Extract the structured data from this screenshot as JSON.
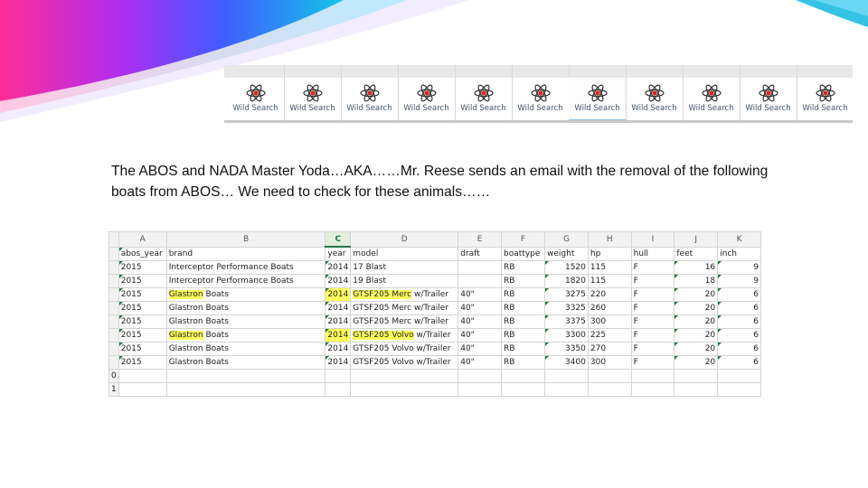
{
  "toolbar": {
    "buttons": [
      {
        "label": "Wild Search",
        "icon": "atom-icon"
      },
      {
        "label": "Wild Search",
        "icon": "atom-icon"
      },
      {
        "label": "Wild Search",
        "icon": "atom-icon"
      },
      {
        "label": "Wild Search",
        "icon": "atom-icon"
      },
      {
        "label": "Wild Search",
        "icon": "atom-icon"
      },
      {
        "label": "Wild Search",
        "icon": "atom-icon"
      },
      {
        "label": "Wild Search",
        "icon": "atom-icon",
        "selected": true
      },
      {
        "label": "Wild Search",
        "icon": "atom-icon"
      },
      {
        "label": "Wild Search",
        "icon": "atom-icon"
      },
      {
        "label": "Wild Search",
        "icon": "atom-icon"
      },
      {
        "label": "Wild Search",
        "icon": "atom-icon"
      }
    ]
  },
  "caption": "The ABOS and NADA Master Yoda…AKA……Mr. Reese sends an email with the removal of the following boats from ABOS… We need to check for these animals……",
  "sheet": {
    "selected_column": "C",
    "column_letters": [
      "A",
      "B",
      "C",
      "D",
      "E",
      "F",
      "G",
      "H",
      "I",
      "J",
      "K"
    ],
    "headers": [
      "abos_year",
      "brand",
      "year",
      "model",
      "draft",
      "boattype",
      "weight",
      "hp",
      "hull",
      "feet",
      "inch"
    ],
    "rows": [
      [
        "2015",
        "Interceptor Performance Boats",
        "2014",
        "17 Blast",
        "",
        "RB",
        "1520",
        "115",
        "F",
        "16",
        "9"
      ],
      [
        "2015",
        "Interceptor Performance Boats",
        "2014",
        "19 Blast",
        "",
        "RB",
        "1820",
        "115",
        "F",
        "18",
        "9"
      ],
      [
        "2015",
        "Glastron Boats",
        "2014",
        "GTSF205 Merc w/Trailer",
        "40\"",
        "RB",
        "3275",
        "220",
        "F",
        "20",
        "6"
      ],
      [
        "2015",
        "Glastron Boats",
        "2014",
        "GTSF205 Merc w/Trailer",
        "40\"",
        "RB",
        "3325",
        "260",
        "F",
        "20",
        "6"
      ],
      [
        "2015",
        "Glastron Boats",
        "2014",
        "GTSF205 Merc w/Trailer",
        "40\"",
        "RB",
        "3375",
        "300",
        "F",
        "20",
        "6"
      ],
      [
        "2015",
        "Glastron Boats",
        "2014",
        "GTSF205 Volvo w/Trailer",
        "40\"",
        "RB",
        "3300",
        "225",
        "F",
        "20",
        "6"
      ],
      [
        "2015",
        "Glastron Boats",
        "2014",
        "GTSF205 Volvo w/Trailer",
        "40\"",
        "RB",
        "3350",
        "270",
        "F",
        "20",
        "6"
      ],
      [
        "2015",
        "Glastron Boats",
        "2014",
        "GTSF205 Volvo w/Trailer",
        "40\"",
        "RB",
        "3400",
        "300",
        "F",
        "20",
        "6"
      ]
    ],
    "partial_row_numbers": [
      "0",
      "1"
    ],
    "highlight_color": "#ffff5c"
  },
  "colors": {
    "corner_gradient": [
      "#ff2d95",
      "#9a2cff",
      "#2a6dff",
      "#12c6e8"
    ],
    "excel_green": "#217346"
  }
}
